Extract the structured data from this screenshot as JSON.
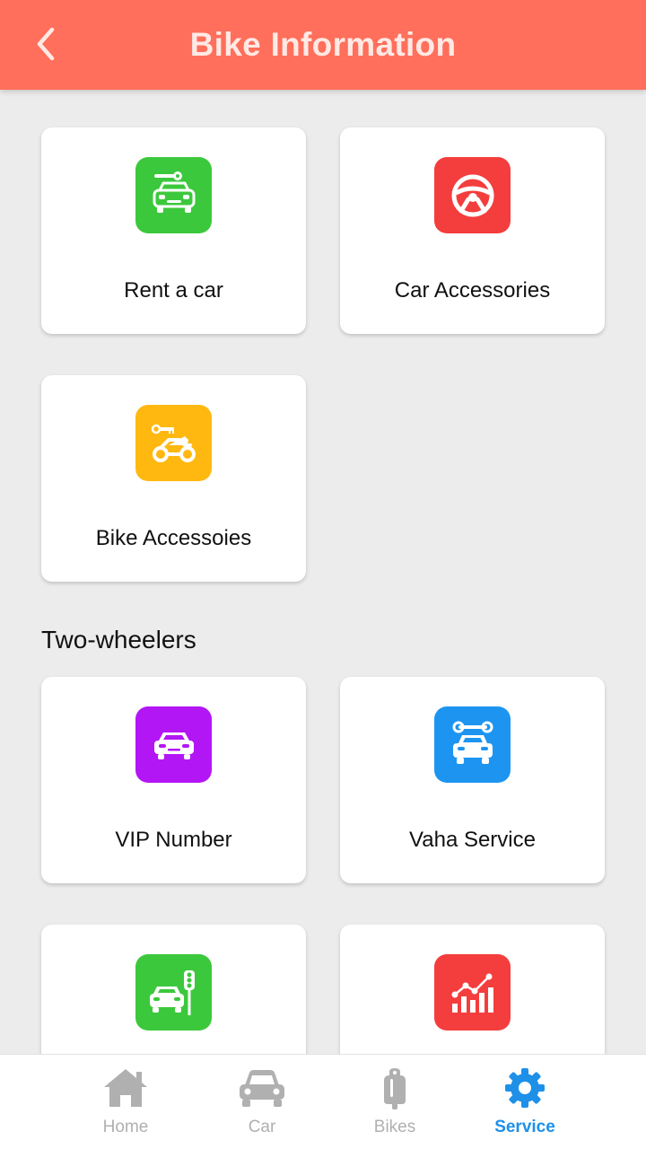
{
  "header": {
    "title": "Bike Information",
    "back_icon": "chevron-left-icon"
  },
  "cards": [
    {
      "label": "Rent a car",
      "icon": "car-key-icon",
      "color": "#3cc83c"
    },
    {
      "label": "Car Accessories",
      "icon": "steering-wheel-icon",
      "color": "#f43d3d"
    },
    {
      "label": "Bike Accessoies",
      "icon": "motorbike-key-icon",
      "color": "#ffb810"
    }
  ],
  "section": {
    "title": "Two-wheelers"
  },
  "two_wheelers": [
    {
      "label": "VIP Number",
      "icon": "car-front-icon",
      "color": "#b316f5"
    },
    {
      "label": "Vaha Service",
      "icon": "car-wrench-icon",
      "color": "#1d95f0"
    },
    {
      "label": "",
      "icon": "car-traffic-light-icon",
      "color": "#3cc83c"
    },
    {
      "label": "",
      "icon": "bar-chart-icon",
      "color": "#f43d3d"
    }
  ],
  "bottom_nav": {
    "items": [
      {
        "label": "Home",
        "icon": "home-icon"
      },
      {
        "label": "Car",
        "icon": "car-icon"
      },
      {
        "label": "Bikes",
        "icon": "bike-icon"
      },
      {
        "label": "Service",
        "icon": "gear-icon"
      }
    ],
    "active": "Service",
    "active_color": "#1e90e8",
    "inactive_color": "#b0b0b0"
  }
}
